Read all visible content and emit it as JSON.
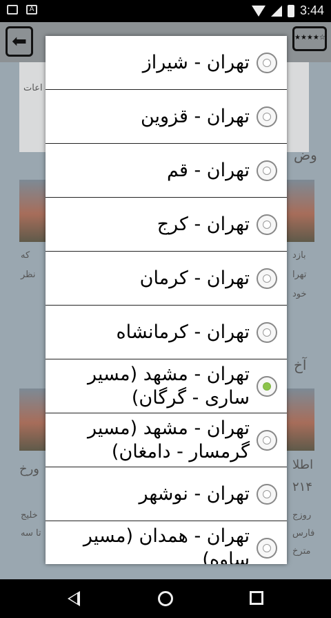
{
  "status_bar": {
    "time": "3:44",
    "left_icons": [
      "image-icon",
      "text-a-icon"
    ],
    "right_icons": [
      "wifi-icon",
      "signal-icon",
      "battery-icon"
    ]
  },
  "background": {
    "rate_stars": "★★★★☆",
    "snippets": [
      "اعات",
      "وض",
      "بازد",
      "که",
      "تهرا",
      "نظر",
      "خود",
      "آخ",
      "اطلا",
      "۲۱۴",
      "ورخ",
      "روزج",
      "خلیج",
      "فارس",
      "تا سه",
      "مترخ"
    ]
  },
  "dialog": {
    "options": [
      {
        "label": "تهران - شیراز",
        "checked": false
      },
      {
        "label": "تهران - قزوین",
        "checked": false
      },
      {
        "label": "تهران - قم",
        "checked": false
      },
      {
        "label": "تهران - کرج",
        "checked": false
      },
      {
        "label": "تهران - کرمان",
        "checked": false
      },
      {
        "label": "تهران - کرمانشاه",
        "checked": false
      },
      {
        "label": "تهران - مشهد (مسیر ساری - گرگان)",
        "checked": true
      },
      {
        "label": "تهران - مشهد (مسیر گرمسار - دامغان)",
        "checked": false
      },
      {
        "label": "تهران - نوشهر",
        "checked": false
      },
      {
        "label": "تهران - همدان (مسیر ساوه)",
        "checked": false
      }
    ]
  },
  "colors": {
    "radio_selected": "#8bc34a"
  }
}
